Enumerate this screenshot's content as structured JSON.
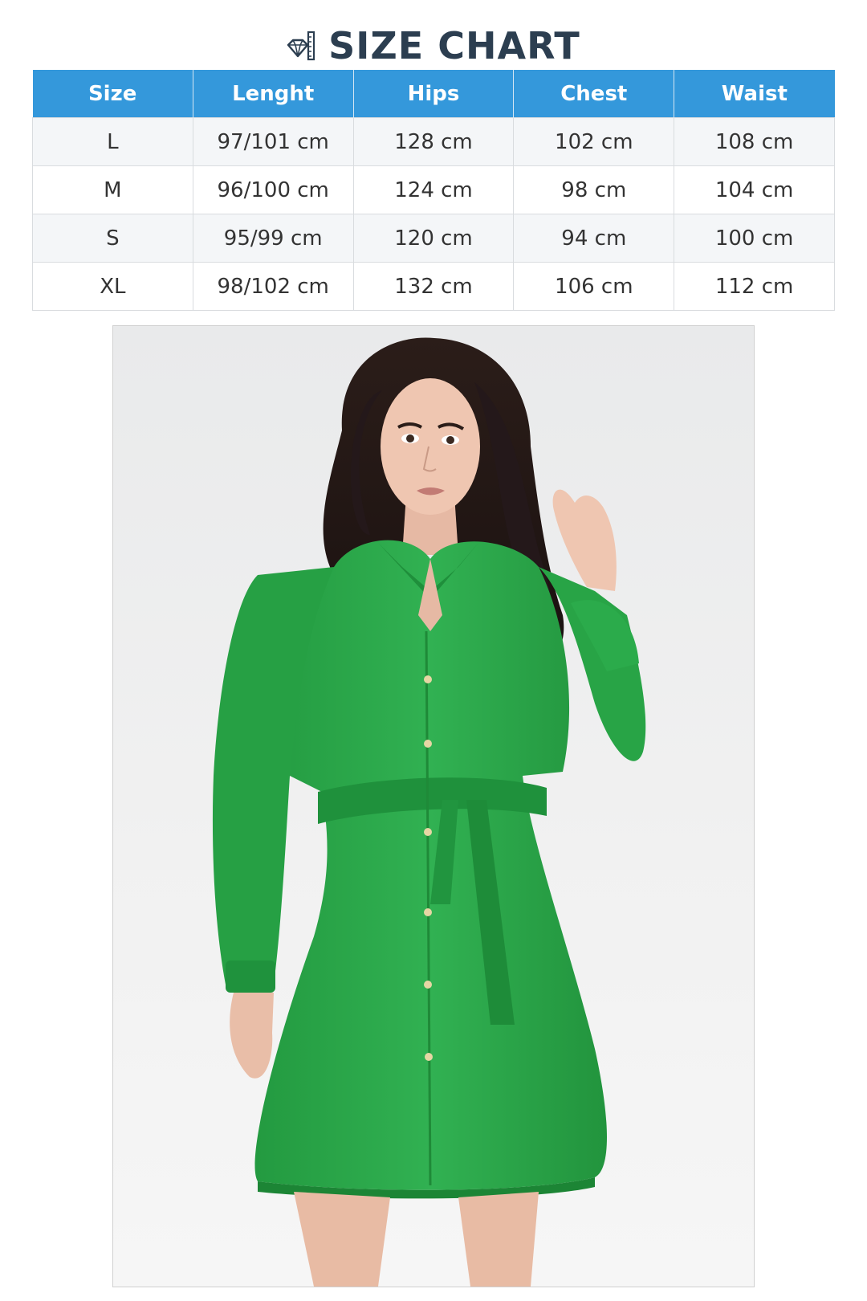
{
  "header": {
    "title": "SIZE CHART",
    "icon": "diamond-ruler-icon"
  },
  "size_table": {
    "columns": [
      "Size",
      "Lenght",
      "Hips",
      "Chest",
      "Waist"
    ],
    "rows": [
      [
        "L",
        "97/101 cm",
        "128 cm",
        "102 cm",
        "108 cm"
      ],
      [
        "M",
        "96/100 cm",
        "124 cm",
        "98 cm",
        "104 cm"
      ],
      [
        "S",
        "95/99 cm",
        "120 cm",
        "94 cm",
        "100 cm"
      ],
      [
        "XL",
        "98/102 cm",
        "132 cm",
        "106 cm",
        "112 cm"
      ]
    ],
    "header_color": "#3498db",
    "title_color": "#2c3e50"
  },
  "product_photo": {
    "dress_color": "#2eaa4c"
  }
}
